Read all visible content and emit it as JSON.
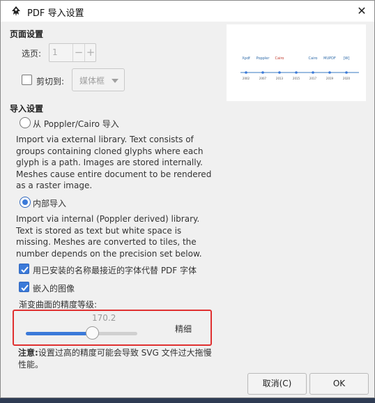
{
  "window": {
    "title": "PDF 导入设置",
    "close_glyph": "✕"
  },
  "page_settings": {
    "heading": "页面设置",
    "page_label": "选页:",
    "page_value": "1",
    "minus": "−",
    "plus": "+",
    "clip_label": "剪切到:",
    "clip_option": "媒体框"
  },
  "preview": {
    "years": [
      "2002",
      "2007",
      "2013",
      "2015",
      "2017",
      "2019",
      "2020"
    ],
    "logos": [
      "Xpdf",
      "Poppler",
      "Cairo",
      "",
      "Cairo",
      "MUPDF",
      "[W]"
    ]
  },
  "import_settings": {
    "heading": "导入设置",
    "option_external_label": "从 Poppler/Cairo 导入",
    "option_external_desc": "Import via external library. Text consists of groups containing cloned glyphs where each glyph is a path. Images are stored internally. Meshes cause entire document to be rendered as a raster image.",
    "option_internal_label": "内部导入",
    "option_internal_desc": "Import via internal (Poppler derived) library. Text is stored as text but white space is missing. Meshes are converted to tiles, the number depends on the precision set below.",
    "replace_fonts_label": "用已安装的名称最接近的字体代替 PDF 字体",
    "embed_images_label": "嵌入的图像",
    "precision_label": "渐变曲面的精度等级:",
    "precision_value": "170.2",
    "precision_fraction": 0.6,
    "precision_quality": "精细",
    "note_bold": "注意:",
    "note_text": "设置过高的精度可能会导致 SVG 文件过大拖慢性能。"
  },
  "buttons": {
    "cancel": "取消(C)",
    "ok": "OK"
  },
  "colors": {
    "accent": "#3b7ad9",
    "highlight": "#e03030"
  }
}
